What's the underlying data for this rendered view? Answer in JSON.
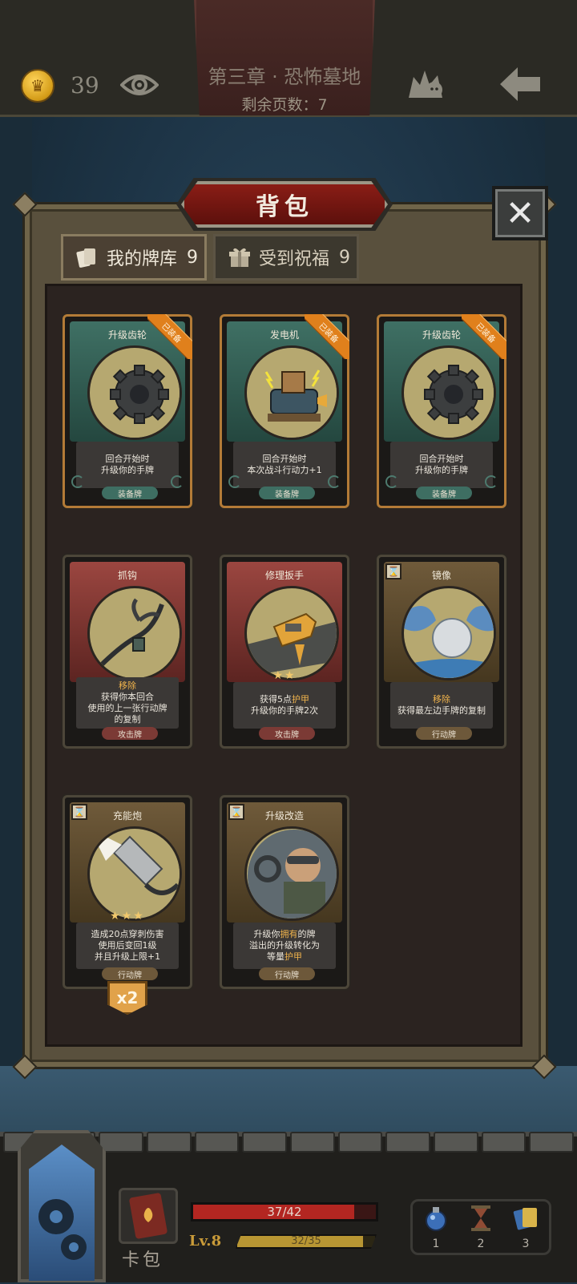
{
  "header": {
    "coins": "39",
    "chapter_title": "第三章 · 恐怖墓地",
    "pages_remaining": "剩余页数：7"
  },
  "panel": {
    "title": "背包",
    "close_label": "✕",
    "tabs": [
      {
        "label": "我的牌库",
        "count": "9"
      },
      {
        "label": "受到祝福",
        "count": "9"
      }
    ]
  },
  "cards": [
    {
      "name": "升级齿轮",
      "ribbon": "已装备",
      "desc1": "回合开始时",
      "desc2": "升级你的手牌",
      "desc3": "",
      "desc4": "",
      "type": "装备牌"
    },
    {
      "name": "发电机",
      "ribbon": "已装备",
      "desc1": "回合开始时",
      "desc2": "本次战斗行动力+1",
      "desc3": "",
      "desc4": "",
      "type": "装备牌"
    },
    {
      "name": "升级齿轮",
      "ribbon": "已装备",
      "desc1": "回合开始时",
      "desc2": "升级你的手牌",
      "desc3": "",
      "desc4": "",
      "type": "装备牌"
    },
    {
      "name": "抓钩",
      "kw": "移除",
      "desc1": "获得你本回合",
      "desc2": "使用的上一张行动牌",
      "desc3": "的复制",
      "type": "攻击牌"
    },
    {
      "name": "修理扳手",
      "stars": "★★",
      "desc1a": "获得5点",
      "desc1kw": "护甲",
      "desc2": "升级你的手牌2次",
      "type": "攻击牌"
    },
    {
      "name": "镜像",
      "kw": "移除",
      "desc1": "获得最左边手牌的复制",
      "type": "行动牌"
    },
    {
      "name": "充能炮",
      "stars": "★★★",
      "desc1": "造成20点穿刺伤害",
      "desc2": "使用后变回1级",
      "desc3": "并且升级上限+1",
      "type": "行动牌"
    },
    {
      "name": "升级改造",
      "desc1a": "升级你",
      "desc1kw": "拥有",
      "desc1b": "的牌",
      "desc2": "溢出的升级转化为",
      "desc3a": "等量",
      "desc3kw": "护甲",
      "type": "行动牌"
    }
  ],
  "x2_badge": "x2",
  "hud": {
    "deck_label": "卡包",
    "hp": "37/42",
    "hp_fraction": 0.881,
    "level": "Lv.8",
    "xp": "32/35",
    "xp_fraction": 0.914,
    "items": [
      "1",
      "2",
      "3"
    ]
  },
  "colors": {
    "accent_red": "#b32621",
    "equipped_ribbon": "#e0801c",
    "keyword": "#f0b34c"
  }
}
